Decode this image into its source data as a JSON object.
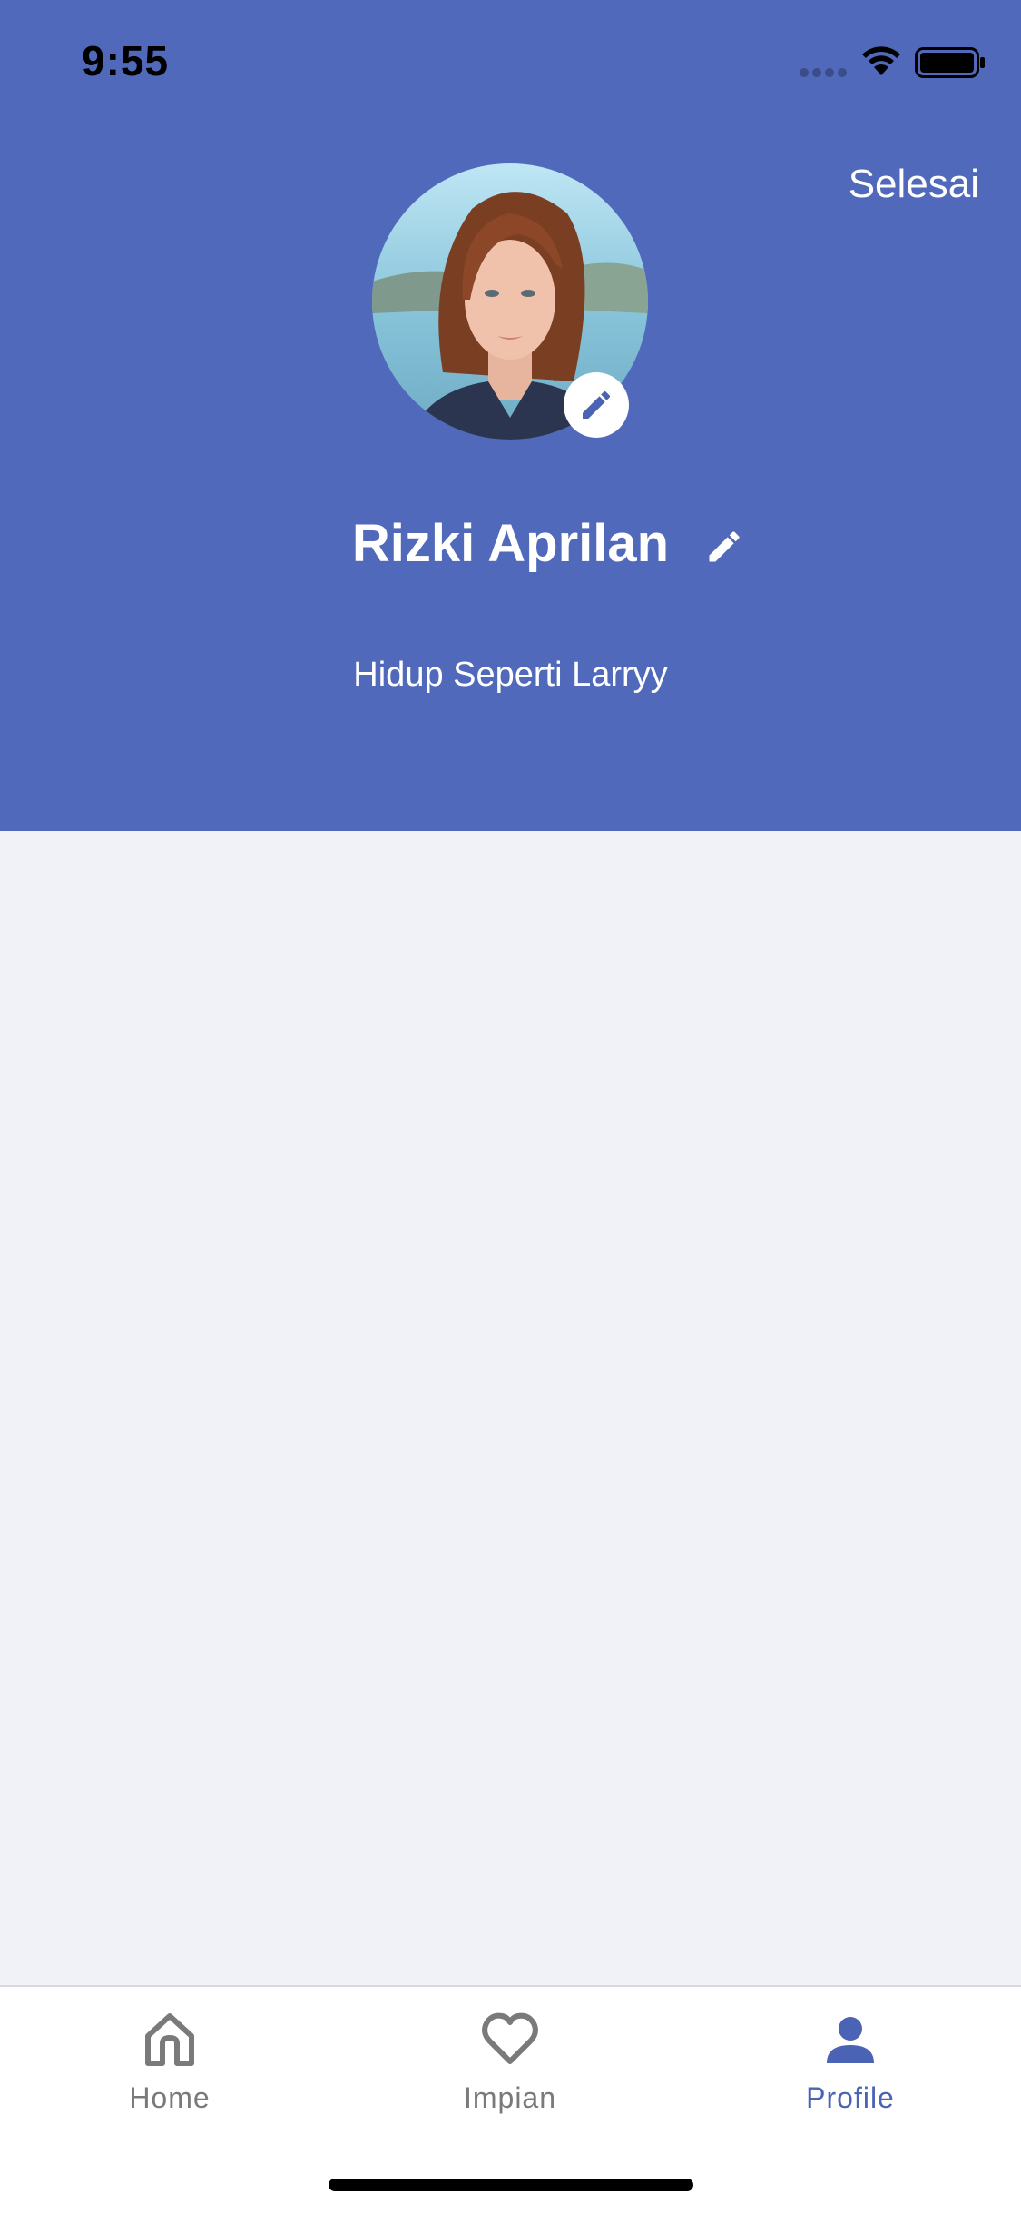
{
  "status_bar": {
    "time": "9:55"
  },
  "header": {
    "done_label": "Selesai",
    "background_color": "#5069BA"
  },
  "profile": {
    "name": "Rizki Aprilan",
    "bio": "Hidup Seperti Larryy",
    "avatar_icon": "avatar-photo"
  },
  "tabs": [
    {
      "label": "Home",
      "icon": "home-icon",
      "active": false
    },
    {
      "label": "Impian",
      "icon": "heart-icon",
      "active": false
    },
    {
      "label": "Profile",
      "icon": "person-icon",
      "active": true
    }
  ],
  "colors": {
    "accent": "#4A63B4",
    "inactive": "#7A7A7A",
    "body_background": "#F0F2F7"
  }
}
